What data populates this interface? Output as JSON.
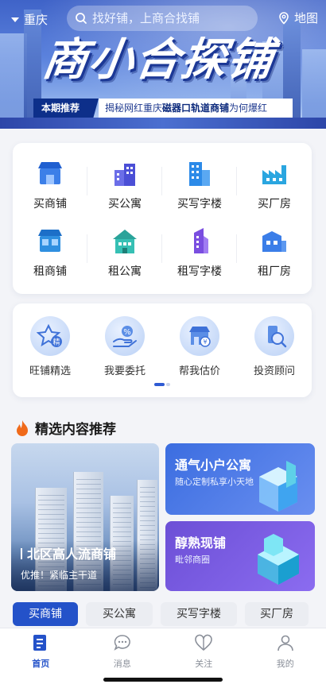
{
  "header": {
    "city": "重庆",
    "search_placeholder": "找好铺，上商合找铺",
    "map_label": "地图"
  },
  "banner": {
    "title": "商小合探铺",
    "tag": "本期推荐",
    "text_pre": "揭秘网红重庆",
    "text_bold": "磁器口轨道商铺",
    "text_post": "为何爆红"
  },
  "categories": [
    {
      "label": "买商铺",
      "icon": "shop-icon"
    },
    {
      "label": "买公寓",
      "icon": "apartment-icon"
    },
    {
      "label": "买写字楼",
      "icon": "office-icon"
    },
    {
      "label": "买厂房",
      "icon": "factory-icon"
    },
    {
      "label": "租商铺",
      "icon": "shop-icon"
    },
    {
      "label": "租公寓",
      "icon": "apartment-icon"
    },
    {
      "label": "租写字楼",
      "icon": "office-icon"
    },
    {
      "label": "租厂房",
      "icon": "factory-icon"
    }
  ],
  "services": [
    {
      "label": "旺铺精选",
      "icon": "star-badge-icon",
      "badge": "精"
    },
    {
      "label": "我要委托",
      "icon": "hand-percent-icon"
    },
    {
      "label": "帮我估价",
      "icon": "shop-price-icon"
    },
    {
      "label": "投资顾问",
      "icon": "advisor-icon"
    }
  ],
  "section": {
    "title": "精选内容推荐"
  },
  "featured": {
    "big": {
      "title": "北区高人流商铺",
      "subtitle": "优推！紧临主干道"
    },
    "a": {
      "title": "通气小户公寓",
      "subtitle": "随心定制私享小天地"
    },
    "b": {
      "title": "醇熟现铺",
      "subtitle": "毗邻商圈"
    }
  },
  "tabs": [
    {
      "label": "买商铺",
      "active": true
    },
    {
      "label": "买公寓",
      "active": false
    },
    {
      "label": "买写字楼",
      "active": false
    },
    {
      "label": "买厂房",
      "active": false
    }
  ],
  "nav": [
    {
      "label": "首页",
      "icon": "home-list-icon",
      "active": true
    },
    {
      "label": "消息",
      "icon": "message-icon",
      "active": false
    },
    {
      "label": "关注",
      "icon": "heart-icon",
      "active": false
    },
    {
      "label": "我的",
      "icon": "profile-icon",
      "active": false
    }
  ],
  "colors": {
    "brand": "#2452c9",
    "accent_dark": "#0d2f8a"
  }
}
